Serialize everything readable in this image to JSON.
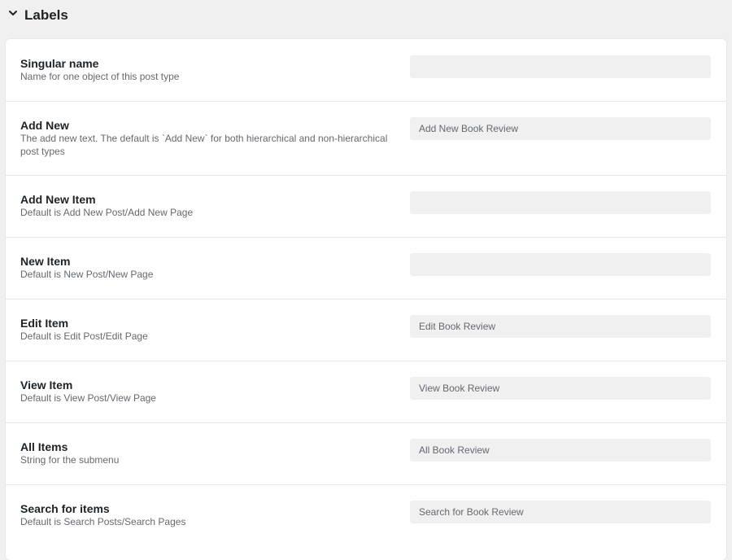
{
  "section": {
    "title": "Labels",
    "toggle_icon": "chevron-down-icon"
  },
  "fields": [
    {
      "label": "Singular name",
      "description": "Name for one object of this post type",
      "value": ""
    },
    {
      "label": "Add New",
      "description": "The add new text. The default is `Add New` for both hierarchical and non-hierarchical post types",
      "value": "Add New Book Review"
    },
    {
      "label": "Add New Item",
      "description": "Default is Add New Post/Add New Page",
      "value": ""
    },
    {
      "label": "New Item",
      "description": "Default is New Post/New Page",
      "value": ""
    },
    {
      "label": "Edit Item",
      "description": "Default is Edit Post/Edit Page",
      "value": "Edit Book Review"
    },
    {
      "label": "View Item",
      "description": "Default is View Post/View Page",
      "value": "View Book Review"
    },
    {
      "label": "All Items",
      "description": "String for the submenu",
      "value": "All Book Review"
    },
    {
      "label": "Search for items",
      "description": "Default is Search Posts/Search Pages",
      "value": "Search for Book Review"
    }
  ]
}
